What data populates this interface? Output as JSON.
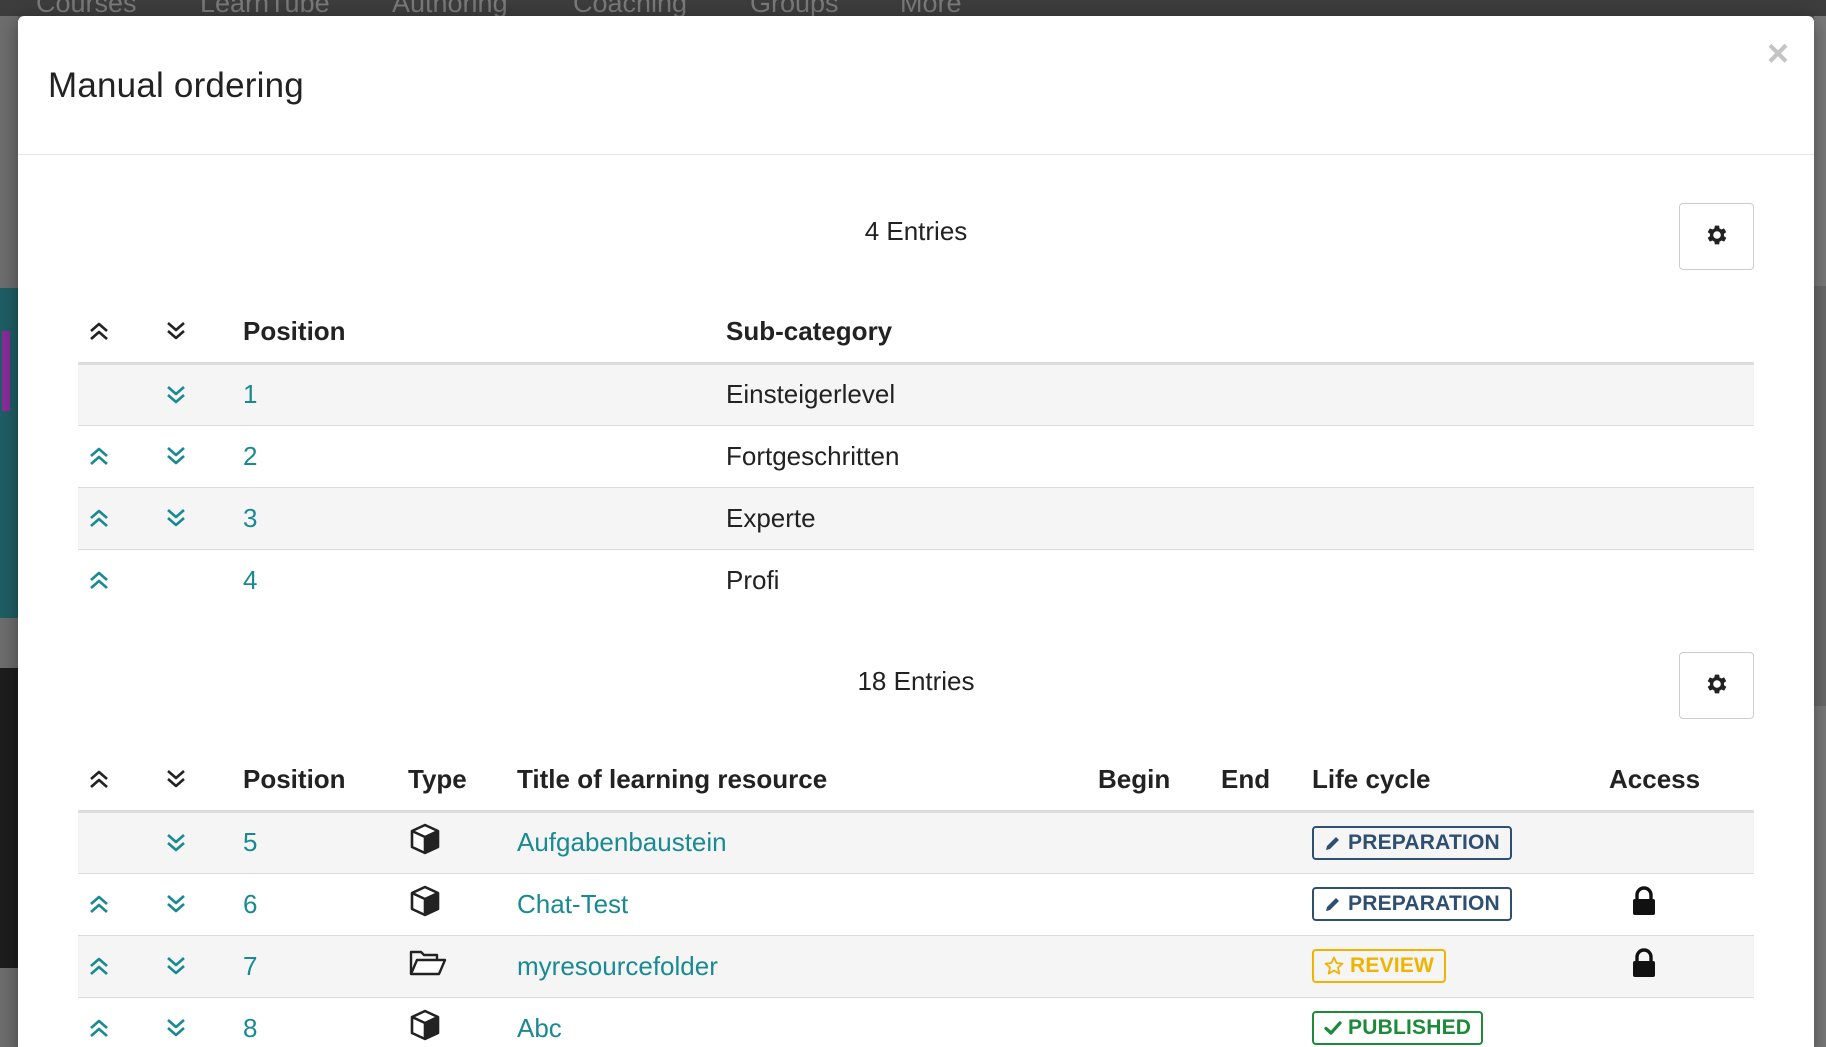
{
  "background": {
    "nav_items": [
      "Courses",
      "LearnTube",
      "Authoring",
      "Coaching",
      "Groups",
      "More"
    ]
  },
  "modal": {
    "title": "Manual ordering",
    "close_label": "×"
  },
  "subcategories": {
    "entries_label": "4 Entries",
    "columns": {
      "position": "Position",
      "subcategory": "Sub-category"
    },
    "rows": [
      {
        "position": "1",
        "name": "Einsteigerlevel",
        "up": false,
        "down": true
      },
      {
        "position": "2",
        "name": "Fortgeschritten",
        "up": true,
        "down": true
      },
      {
        "position": "3",
        "name": "Experte",
        "up": true,
        "down": true
      },
      {
        "position": "4",
        "name": "Profi",
        "up": true,
        "down": false
      }
    ]
  },
  "resources": {
    "entries_label": "18 Entries",
    "columns": {
      "position": "Position",
      "type": "Type",
      "title": "Title of learning resource",
      "begin": "Begin",
      "end": "End",
      "lifecycle": "Life cycle",
      "access": "Access"
    },
    "rows": [
      {
        "position": "5",
        "type_icon": "cube-icon",
        "title": "Aufgabenbaustein",
        "begin": "",
        "end": "",
        "status": "PREPARATION",
        "status_kind": "prep",
        "locked": false,
        "up": false,
        "down": true
      },
      {
        "position": "6",
        "type_icon": "cube-icon",
        "title": "Chat-Test",
        "begin": "",
        "end": "",
        "status": "PREPARATION",
        "status_kind": "prep",
        "locked": true,
        "up": true,
        "down": true
      },
      {
        "position": "7",
        "type_icon": "folder-open-icon",
        "title": "myresourcefolder",
        "begin": "",
        "end": "",
        "status": "REVIEW",
        "status_kind": "review",
        "locked": true,
        "up": true,
        "down": true
      },
      {
        "position": "8",
        "type_icon": "cube-icon",
        "title": "Abc",
        "begin": "",
        "end": "",
        "status": "PUBLISHED",
        "status_kind": "pub",
        "locked": false,
        "up": true,
        "down": true
      }
    ]
  },
  "colors": {
    "accent": "#1a8a92",
    "preparation": "#2e4f72",
    "review": "#f0b400",
    "published": "#1d8a3a"
  }
}
